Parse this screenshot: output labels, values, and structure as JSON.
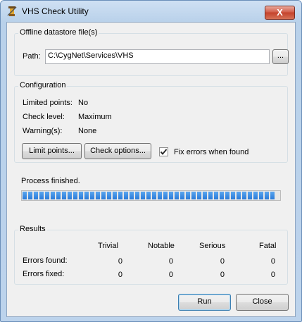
{
  "window": {
    "title": "VHS Check Utility",
    "icon": "tool-icon",
    "close_glyph": "X"
  },
  "datastore": {
    "group_label": "Offline datastore file(s)",
    "path_label": "Path:",
    "path_value": "C:\\CygNet\\Services\\VHS",
    "browse_label": "..."
  },
  "configuration": {
    "group_label": "Configuration",
    "limited_points_label": "Limited points:",
    "limited_points_value": "No",
    "check_level_label": "Check level:",
    "check_level_value": "Maximum",
    "warnings_label": "Warning(s):",
    "warnings_value": "None",
    "limit_points_button": "Limit points...",
    "check_options_button": "Check options...",
    "fix_errors_label": "Fix errors when found",
    "fix_errors_checked": true
  },
  "status": {
    "text": "Process finished.",
    "progress_percent": 100
  },
  "results": {
    "group_label": "Results",
    "columns": [
      "Trivial",
      "Notable",
      "Serious",
      "Fatal"
    ],
    "rows": [
      {
        "label": "Errors found:",
        "values": [
          "0",
          "0",
          "0",
          "0"
        ]
      },
      {
        "label": "Errors fixed:",
        "values": [
          "0",
          "0",
          "0",
          "0"
        ]
      }
    ]
  },
  "buttons": {
    "run": "Run",
    "close": "Close"
  },
  "colors": {
    "progress": "#3587e0",
    "title_bar": "#b9d1ea",
    "close_button": "#c4422c"
  }
}
